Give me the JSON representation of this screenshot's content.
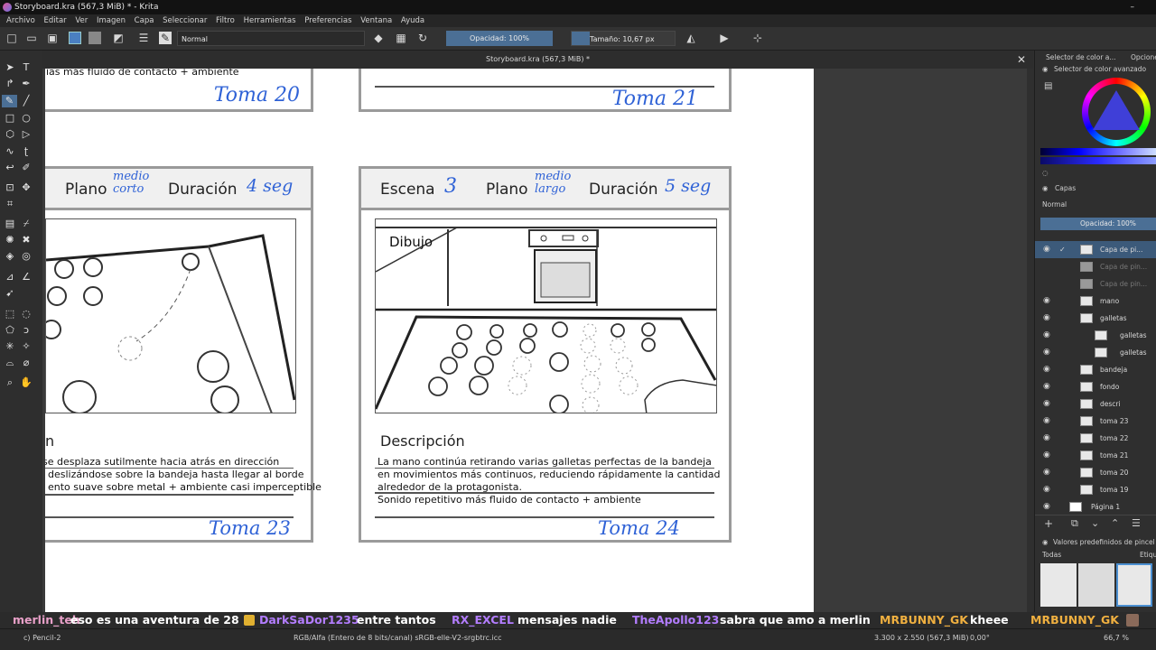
{
  "window": {
    "title": "Storyboard.kra (567,3 MiB) * - Krita"
  },
  "menu": [
    "Archivo",
    "Editar",
    "Ver",
    "Imagen",
    "Capa",
    "Seleccionar",
    "Filtro",
    "Herramientas",
    "Preferencias",
    "Ventana",
    "Ayuda"
  ],
  "toolbar": {
    "blend_mode": "Normal",
    "opacity": "Opacidad: 100%",
    "size": "Tamaño: 10,67 px"
  },
  "document_tab": {
    "title": "Storyboard.kra (567,3 MiB) *"
  },
  "storyboard": {
    "top_left": {
      "text_fragment": "ias más fluido de contacto + ambiente",
      "toma": "Toma 20"
    },
    "top_right": {
      "toma": "Toma 21"
    },
    "left_panel": {
      "plano": "Plano",
      "plano_value": "medio corto",
      "duracion": "Duración",
      "duracion_value": "4 seg",
      "desc_title_fragment": "n",
      "lines": [
        "se desplaza sutilmente hacia atrás en dirección",
        "deslizándose sobre la bandeja hasta llegar al borde",
        "ento suave sobre metal + ambiente casi imperceptible"
      ],
      "toma": "Toma 23"
    },
    "right_panel": {
      "escena": "Escena",
      "escena_value": "3",
      "plano": "Plano",
      "plano_value": "medio largo",
      "duracion": "Duración",
      "duracion_value": "5 seg",
      "dibujo": "Dibujo",
      "desc_title": "Descripción",
      "lines": [
        "La mano continúa retirando varias galletas perfectas de la bandeja",
        "en movimientos más continuos, reduciendo rápidamente la cantidad",
        "alrededor de la protagonista.",
        "Sonido repetitivo más fluido de contacto + ambiente"
      ],
      "toma": "Toma 24"
    }
  },
  "dock": {
    "tab_color": "Selector de color a...",
    "tab_options": "Opcione",
    "advanced_color": "Selector de color avanzado",
    "layers_title": "Capas",
    "blend": "Normal",
    "opacity": "Opacidad: 100%",
    "layers": [
      "Capa de pi...",
      "Capa de pin...",
      "Capa de pin...",
      "mano",
      "galletas",
      "galletas",
      "galletas",
      "bandeja",
      "fondo",
      "descri",
      "toma 23",
      "toma 22",
      "toma 21",
      "toma 20",
      "toma 19",
      "Página 1"
    ],
    "brush_presets_title": "Valores predefinidos de pincel",
    "brush_filter": "Todas",
    "brush_tag": "Etiqu"
  },
  "chat": [
    {
      "user": "merlin_teh",
      "msg": "eso es una aventura de 28",
      "color": "#e8a0c8"
    },
    {
      "user": "DarkSaDor1235",
      "msg": "entre tantos",
      "color": "#b37dff"
    },
    {
      "user": "RX_EXCEL",
      "msg": "mensajes nadie",
      "color": "#b37dff"
    },
    {
      "user": "TheApollo123",
      "msg": "sabra que amo a merlin",
      "color": "#b37dff"
    },
    {
      "user": "MRBUNNY_GK",
      "msg": "kheee",
      "color": "#f0b040"
    },
    {
      "user": "MRBUNNY_GK",
      "msg": "",
      "color": "#f0b040"
    }
  ],
  "status": {
    "brush": "c) Pencil-2",
    "color_info": "RGB/Alfa (Entero de 8 bits/canal)  sRGB-elle-V2-srgbtrc.icc",
    "size": "3.300 x 2.550 (567,3 MiB)",
    "rotation": "0,00°",
    "zoom": "66,7 %"
  }
}
